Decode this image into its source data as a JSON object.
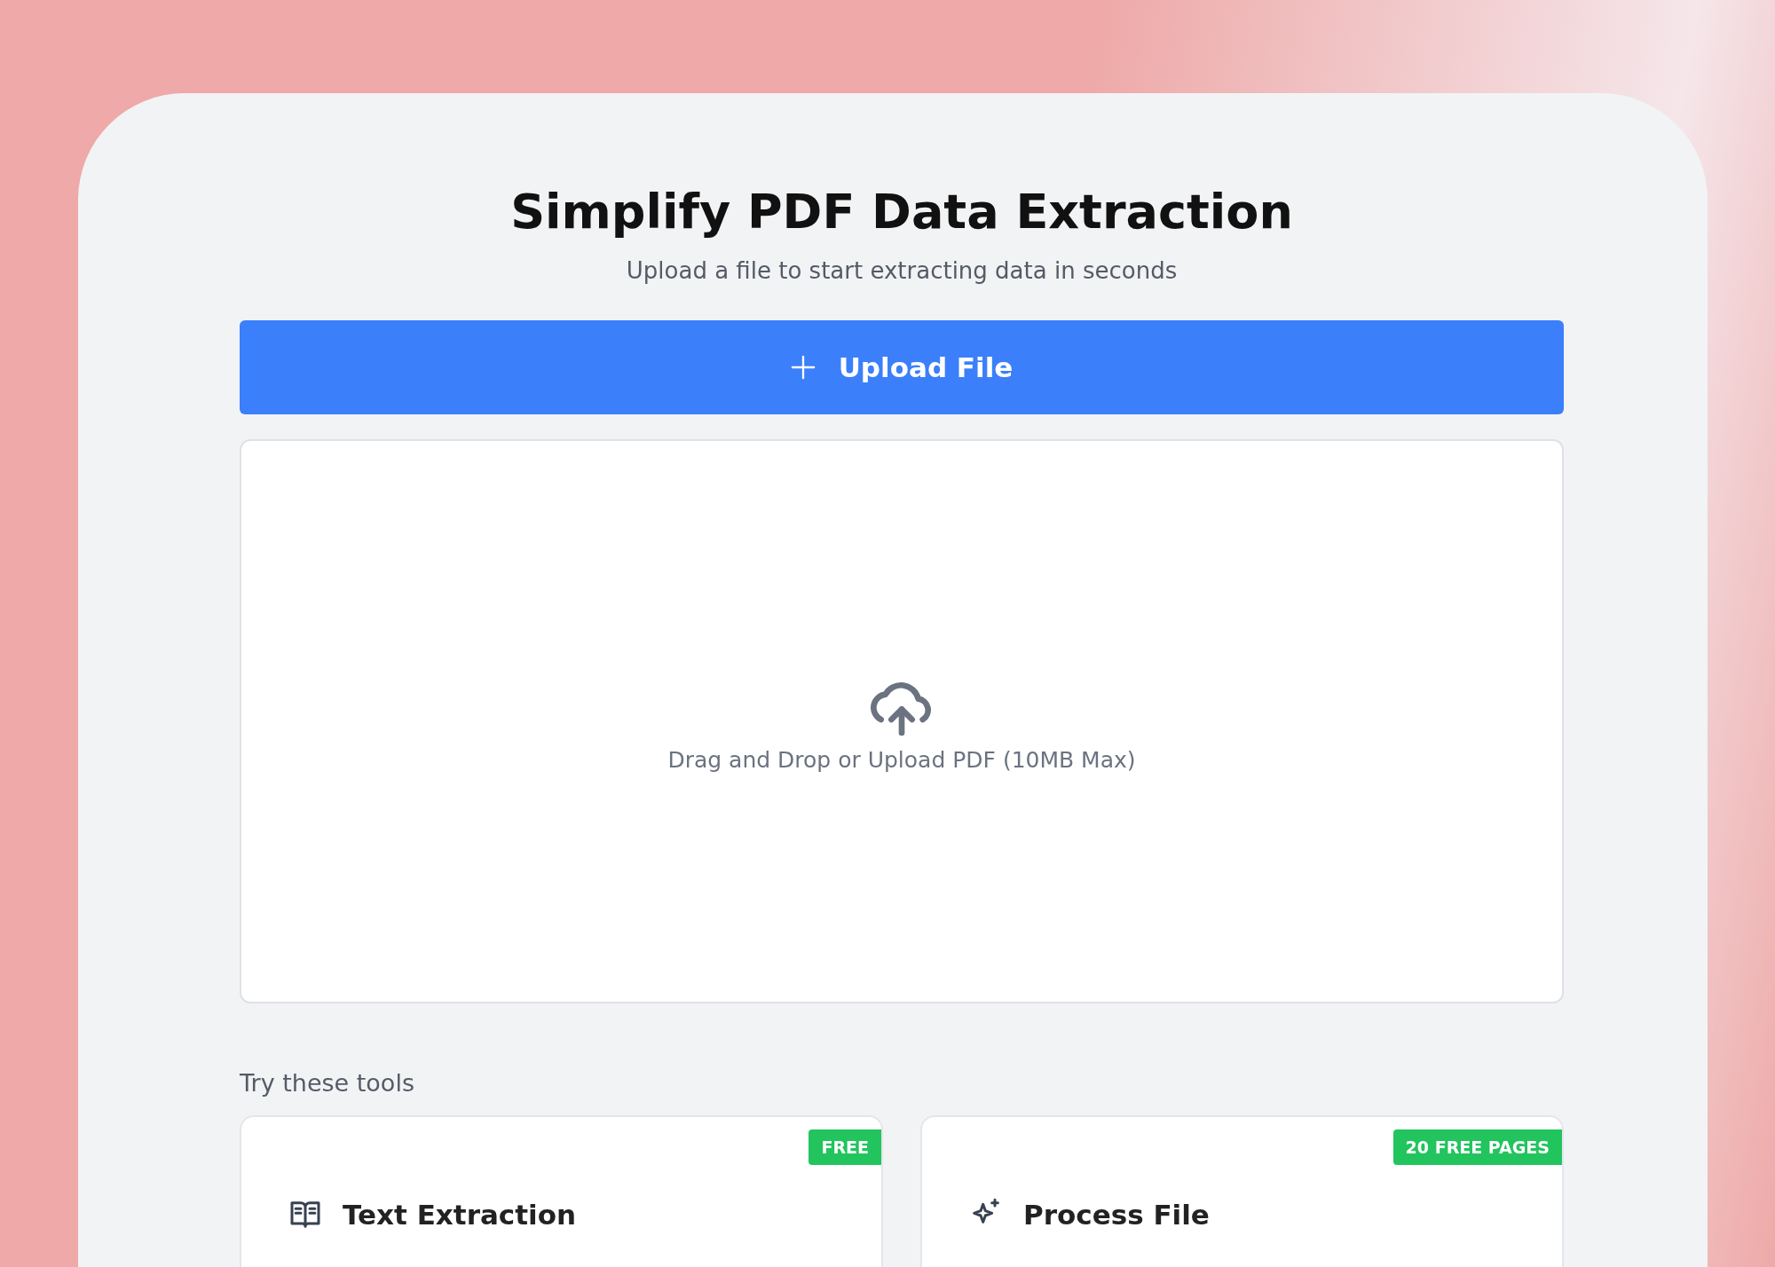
{
  "header": {
    "title": "Simplify PDF Data Extraction",
    "subtitle": "Upload a file to start extracting data in seconds"
  },
  "upload_button": {
    "label": "Upload File"
  },
  "drop_zone": {
    "text": "Drag and Drop or Upload PDF (10MB Max)"
  },
  "tools": {
    "heading": "Try these tools",
    "items": [
      {
        "kind": "book",
        "title": "Text Extraction",
        "badge": "FREE"
      },
      {
        "kind": "sparkle",
        "title": "Process File",
        "badge": "20 FREE PAGES"
      }
    ]
  }
}
